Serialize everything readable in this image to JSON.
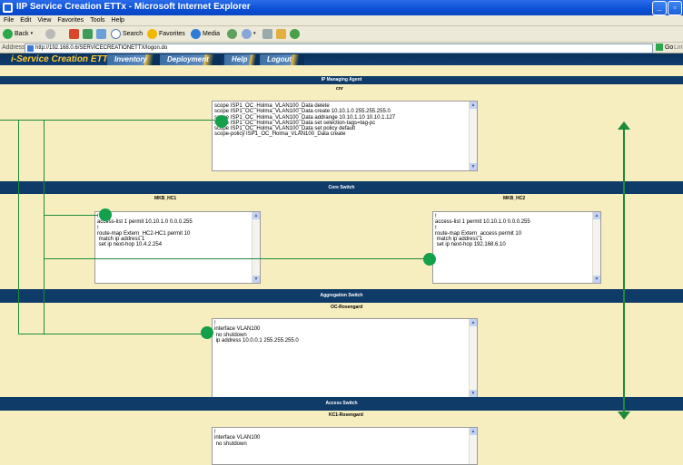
{
  "window": {
    "title": "IIP Service Creation ETTx - Microsoft Internet Explorer"
  },
  "menu": [
    "File",
    "Edit",
    "View",
    "Favorites",
    "Tools",
    "Help"
  ],
  "toolbar": {
    "back": "Back",
    "search": "Search",
    "favorites": "Favorites",
    "media": "Media"
  },
  "address": {
    "label": "Address",
    "url": "http://192.168.0.6/SERVICECREATIONETTX/logon.do",
    "go": "Go",
    "links": "Links"
  },
  "app": {
    "brand": "i-Service Creation ETTx",
    "tabs": [
      "Inventory",
      "Deployment",
      "Help",
      "Logout"
    ]
  },
  "sections": {
    "ipma": {
      "title": "IP Managing Agent",
      "device": "cnr",
      "config": [
        "",
        "",
        "scope ISP1_OC_Holma_VLAN100_Data delete",
        "scope ISP1_OC_Holma_VLAN100_Data create 10.10.1.0 255.255.255.0",
        "scope ISP1_OC_Holma_VLAN100_Data addrange 10.10.1.10 10.10.1.127",
        "scope ISP1_OC_Holma_VLAN100_Data set selection-tags=tag-pc",
        "",
        "scope ISP1_OC_Holma_VLAN100_Data set policy default",
        "scope-policy ISP1_OC_Holma_VLAN100_Data create"
      ]
    },
    "core": {
      "title": "Core Switch",
      "left": {
        "device": "MKB_HC1",
        "config": [
          "",
          "!",
          "",
          "access-list 1 permit 10.10.1.0 0.0.0.255",
          "!",
          "",
          "route-map Extern_HC2-HC1 permit 10",
          " match ip address 1",
          " set ip next-hop 10.4.2.254"
        ]
      },
      "right": {
        "device": "MKB_HC2",
        "config": [
          "",
          "!",
          "",
          "access-list 1 permit 10.10.1.0 0.0.0.255",
          "!",
          "",
          "route-map Extern_access permit 10",
          " match ip address 1",
          " set ip next-hop 192.168.6.10"
        ]
      }
    },
    "agg": {
      "title": "Aggregation Switch",
      "device": "OC-Rosengard",
      "config": [
        "",
        "!",
        "",
        "interface VLAN100",
        " no shutdown",
        " ip address 10.0.0.1 255.255.255.0"
      ]
    },
    "access": {
      "title": "Access Switch",
      "device": "KC1-Rosengard",
      "config": [
        "",
        "!",
        "",
        "interface VLAN100",
        " no shutdown"
      ]
    }
  },
  "colors": {
    "accent": "#13a04a",
    "nav": "#0f3b68",
    "background": "#f7eec0"
  }
}
